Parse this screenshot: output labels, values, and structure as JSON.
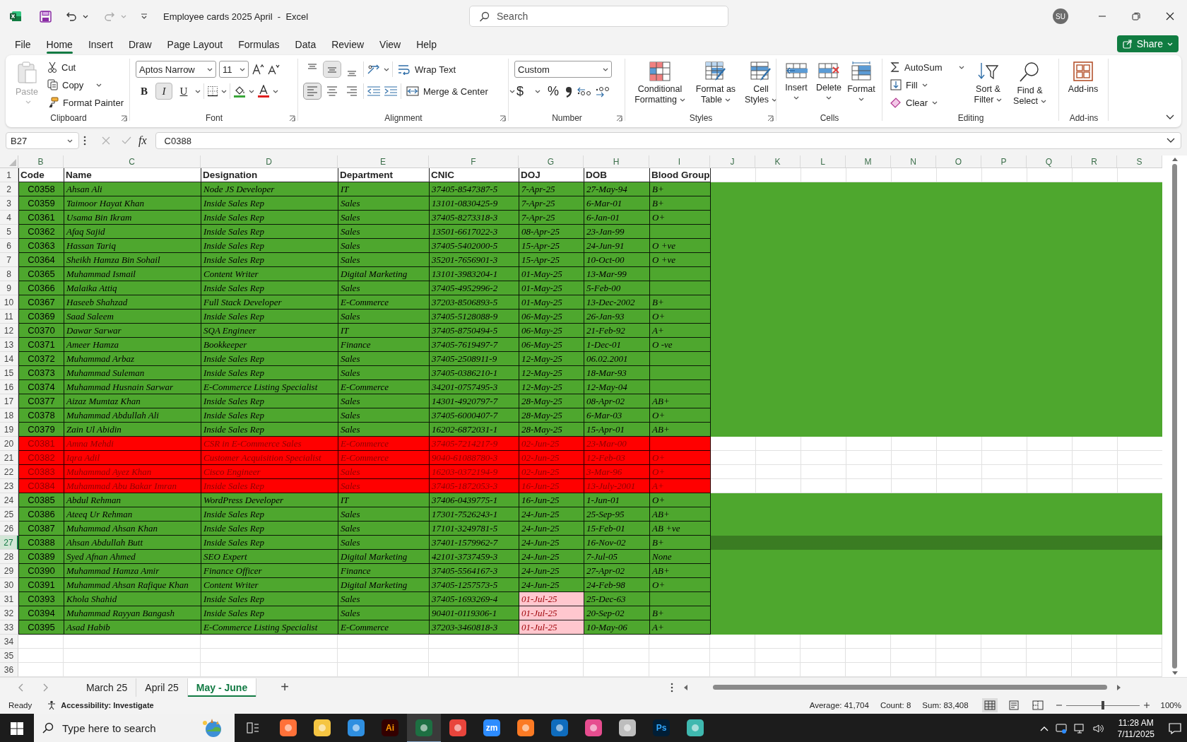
{
  "title_bar": {
    "document_title": "Employee cards 2025 April  -  Excel",
    "search_placeholder": "Search",
    "avatar_initials": "SU"
  },
  "menu_tabs": [
    {
      "label": "File",
      "selected": false
    },
    {
      "label": "Home",
      "selected": true
    },
    {
      "label": "Insert",
      "selected": false
    },
    {
      "label": "Draw",
      "selected": false
    },
    {
      "label": "Page Layout",
      "selected": false
    },
    {
      "label": "Formulas",
      "selected": false
    },
    {
      "label": "Data",
      "selected": false
    },
    {
      "label": "Review",
      "selected": false
    },
    {
      "label": "View",
      "selected": false
    },
    {
      "label": "Help",
      "selected": false
    }
  ],
  "share_button": "Share",
  "ribbon": {
    "groups": [
      {
        "kind": "clipboard",
        "label": "Clipboard",
        "paste": {
          "label": "Paste",
          "disabled": true
        },
        "cut": "Cut",
        "copy": "Copy",
        "format_painter": "Format Painter"
      },
      {
        "kind": "font",
        "label": "Font",
        "font_name": "Aptos Narrow",
        "font_size": "11",
        "styles": [
          {
            "label": "B",
            "selected": false
          },
          {
            "label": "I",
            "selected": true
          },
          {
            "label": "U",
            "selected": false
          }
        ]
      },
      {
        "kind": "alignment",
        "label": "Alignment",
        "vertical": [
          {
            "selected": false
          },
          {
            "selected": true
          },
          {
            "selected": false
          }
        ],
        "horizontal": [
          {
            "selected": true
          },
          {
            "selected": false
          },
          {
            "selected": false
          }
        ],
        "wrap_text": "Wrap Text",
        "merge": "Merge & Center"
      },
      {
        "kind": "number",
        "label": "Number",
        "format": "Custom",
        "currency": "$",
        "percent": "%"
      },
      {
        "kind": "styles",
        "label": "Styles",
        "buttons": [
          "Conditional Formatting",
          "Format as Table",
          "Cell Styles"
        ]
      },
      {
        "kind": "cells",
        "label": "Cells",
        "buttons": [
          "Insert",
          "Delete",
          "Format"
        ]
      },
      {
        "kind": "editing",
        "label": "Editing",
        "autosum": "AutoSum",
        "fill": "Fill",
        "clear": "Clear",
        "sort_filter": "Sort & Filter",
        "find_select": "Find & Select"
      },
      {
        "kind": "addins",
        "label": "Add-ins",
        "buttons": [
          "Add-ins"
        ]
      }
    ]
  },
  "formula_bar": {
    "cell_reference": "B27",
    "function_label": "fx",
    "formula": "C0388"
  },
  "grid": {
    "columns": [
      {
        "letter": "B",
        "heading": "Code"
      },
      {
        "letter": "C",
        "heading": "Name"
      },
      {
        "letter": "D",
        "heading": "Designation"
      },
      {
        "letter": "E",
        "heading": "Department"
      },
      {
        "letter": "F",
        "heading": "CNIC"
      },
      {
        "letter": "G",
        "heading": "DOJ"
      },
      {
        "letter": "H",
        "heading": "DOB"
      },
      {
        "letter": "I",
        "heading": "Blood Group"
      },
      {
        "letter": "J"
      },
      {
        "letter": "K"
      },
      {
        "letter": "L"
      },
      {
        "letter": "M"
      },
      {
        "letter": "N"
      },
      {
        "letter": "O"
      },
      {
        "letter": "P"
      },
      {
        "letter": "Q"
      },
      {
        "letter": "R"
      },
      {
        "letter": "S"
      }
    ],
    "header_row": "1",
    "rows": [
      {
        "number": "2",
        "code": "C0358",
        "name": "Ahsan Ali",
        "designation": "Node JS Developer",
        "department": "IT",
        "cnic": "37405-8547387-5",
        "doj": "7-Apr-25",
        "dob": "27-May-94",
        "blood_group": "B+",
        "color": "#4ea72e",
        "fill_extends": true,
        "selected": false,
        "doj_flagged": false
      },
      {
        "number": "3",
        "code": "C0359",
        "name": "Taimoor Hayat Khan",
        "designation": "Inside Sales Rep",
        "department": "Sales",
        "cnic": "13101-0830425-9",
        "doj": "7-Apr-25",
        "dob": "6-Mar-01",
        "blood_group": "B+",
        "color": "#4ea72e",
        "fill_extends": true,
        "selected": false,
        "doj_flagged": false
      },
      {
        "number": "4",
        "code": "C0361",
        "name": "Usama Bin Ikram",
        "designation": "Inside Sales Rep",
        "department": "Sales",
        "cnic": "37405-8273318-3",
        "doj": "7-Apr-25",
        "dob": "6-Jan-01",
        "blood_group": "O+",
        "color": "#4ea72e",
        "fill_extends": true,
        "selected": false,
        "doj_flagged": false
      },
      {
        "number": "5",
        "code": "C0362",
        "name": "Afaq Sajid",
        "designation": "Inside Sales Rep",
        "department": "Sales",
        "cnic": "13501-6617022-3",
        "doj": "08-Apr-25",
        "dob": "23-Jan-99",
        "color": "#4ea72e",
        "fill_extends": true,
        "selected": false,
        "doj_flagged": false
      },
      {
        "number": "6",
        "code": "C0363",
        "name": "Hassan Tariq",
        "designation": "Inside Sales Rep",
        "department": "Sales",
        "cnic": "37405-5402000-5",
        "doj": "15-Apr-25",
        "dob": "24-Jun-91",
        "blood_group": "O +ve",
        "color": "#4ea72e",
        "fill_extends": true,
        "selected": false,
        "doj_flagged": false
      },
      {
        "number": "7",
        "code": "C0364",
        "name": "Sheikh Hamza Bin Sohail",
        "designation": "Inside Sales Rep",
        "department": "Sales",
        "cnic": "35201-7656901-3",
        "doj": "15-Apr-25",
        "dob": "10-Oct-00",
        "blood_group": "O +ve",
        "color": "#4ea72e",
        "fill_extends": true,
        "selected": false,
        "doj_flagged": false
      },
      {
        "number": "8",
        "code": "C0365",
        "name": "Muhammad Ismail",
        "designation": "Content Writer",
        "department": "Digital Marketing",
        "cnic": "13101-3983204-1",
        "doj": "01-May-25",
        "dob": "13-Mar-99",
        "color": "#4ea72e",
        "fill_extends": true,
        "selected": false,
        "doj_flagged": false
      },
      {
        "number": "9",
        "code": "C0366",
        "name": "Malaika Attiq",
        "designation": "Inside Sales Rep",
        "department": "Sales",
        "cnic": "37405-4952996-2",
        "doj": "01-May-25",
        "dob": "5-Feb-00",
        "color": "#4ea72e",
        "fill_extends": true,
        "selected": false,
        "doj_flagged": false
      },
      {
        "number": "10",
        "code": "C0367",
        "name": "Haseeb Shahzad",
        "designation": "Full Stack Developer",
        "department": "E-Commerce",
        "cnic": "37203-8506893-5",
        "doj": "01-May-25",
        "dob": "13-Dec-2002",
        "blood_group": "B+",
        "color": "#4ea72e",
        "fill_extends": true,
        "selected": false,
        "doj_flagged": false
      },
      {
        "number": "11",
        "code": "C0369",
        "name": "Saad Saleem",
        "designation": "Inside Sales Rep",
        "department": "Sales",
        "cnic": "37405-5128088-9",
        "doj": "06-May-25",
        "dob": "26-Jan-93",
        "blood_group": "O+",
        "color": "#4ea72e",
        "fill_extends": true,
        "selected": false,
        "doj_flagged": false
      },
      {
        "number": "12",
        "code": "C0370",
        "name": "Dawar Sarwar",
        "designation": "SQA Engineer",
        "department": "IT",
        "cnic": "37405-8750494-5",
        "doj": "06-May-25",
        "dob": "21-Feb-92",
        "blood_group": "A+",
        "color": "#4ea72e",
        "fill_extends": true,
        "selected": false,
        "doj_flagged": false
      },
      {
        "number": "13",
        "code": "C0371",
        "name": "Ameer Hamza",
        "designation": "Bookkeeper",
        "department": "Finance",
        "cnic": "37405-7619497-7",
        "doj": "06-May-25",
        "dob": "1-Dec-01",
        "blood_group": "O -ve",
        "color": "#4ea72e",
        "fill_extends": true,
        "selected": false,
        "doj_flagged": false
      },
      {
        "number": "14",
        "code": "C0372",
        "name": "Muhammad Arbaz",
        "designation": "Inside Sales Rep",
        "department": "Sales",
        "cnic": "37405-2508911-9",
        "doj": "12-May-25",
        "dob": "06.02.2001",
        "color": "#4ea72e",
        "fill_extends": true,
        "selected": false,
        "doj_flagged": false
      },
      {
        "number": "15",
        "code": "C0373",
        "name": "Muhammad Suleman",
        "designation": "Inside Sales Rep",
        "department": "Sales",
        "cnic": "37405-0386210-1",
        "doj": "12-May-25",
        "dob": "18-Mar-93",
        "color": "#4ea72e",
        "fill_extends": true,
        "selected": false,
        "doj_flagged": false
      },
      {
        "number": "16",
        "code": "C0374",
        "name": "Muhammad Husnain Sarwar",
        "designation": "E-Commerce Listing Specialist",
        "department": "E-Commerce",
        "cnic": "34201-0757495-3",
        "doj": "12-May-25",
        "dob": "12-May-04",
        "color": "#4ea72e",
        "fill_extends": true,
        "selected": false,
        "doj_flagged": false
      },
      {
        "number": "17",
        "code": "C0377",
        "name": "Aizaz Mumtaz Khan",
        "designation": "Inside Sales Rep",
        "department": "Sales",
        "cnic": "14301-4920797-7",
        "doj": "28-May-25",
        "dob": "08-Apr-02",
        "blood_group": "AB+",
        "color": "#4ea72e",
        "fill_extends": true,
        "selected": false,
        "doj_flagged": false
      },
      {
        "number": "18",
        "code": "C0378",
        "name": "Muhammad Abdullah Ali",
        "designation": "Inside Sales Rep",
        "department": "Sales",
        "cnic": "37405-6000407-7",
        "doj": "28-May-25",
        "dob": "6-Mar-03",
        "blood_group": "O+",
        "color": "#4ea72e",
        "fill_extends": true,
        "selected": false,
        "doj_flagged": false
      },
      {
        "number": "19",
        "code": "C0379",
        "name": "Zain Ul Abidin",
        "designation": "Inside Sales Rep",
        "department": "Sales",
        "cnic": "16202-6872031-1",
        "doj": "28-May-25",
        "dob": "15-Apr-01",
        "blood_group": "AB+",
        "color": "#4ea72e",
        "fill_extends": true,
        "selected": false,
        "doj_flagged": false
      },
      {
        "number": "20",
        "code": "C0381",
        "name": "Amna Mehdi",
        "designation": "CSR in E-Commerce Sales",
        "department": "E-Commerce",
        "cnic": "37405-7214217-9",
        "doj": "02-Jun-25",
        "dob": "23-Mar-00",
        "color": "#ff0000",
        "fill_extends": false,
        "selected": false,
        "doj_flagged": false
      },
      {
        "number": "21",
        "code": "C0382",
        "name": "Iqra Adil",
        "designation": "Customer Acquisition Specialist",
        "department": "E-Commerce",
        "cnic": "9040-61088780-3",
        "doj": "02-Jun-25",
        "dob": "12-Feb-03",
        "blood_group": "O+",
        "color": "#ff0000",
        "fill_extends": false,
        "selected": false,
        "doj_flagged": false
      },
      {
        "number": "22",
        "code": "C0383",
        "name": "Muhammad Ayez Khan",
        "designation": "Cisco Engineer",
        "department": "Sales",
        "cnic": "16203-0372194-9",
        "doj": "02-Jun-25",
        "dob": "3-Mar-96",
        "blood_group": "O+",
        "color": "#ff0000",
        "fill_extends": false,
        "selected": false,
        "doj_flagged": false
      },
      {
        "number": "23",
        "code": "C0384",
        "name": "Muhammad Abu Bakar Imran",
        "designation": "Inside Sales Rep",
        "department": "Sales",
        "cnic": "37405-1872053-3",
        "doj": "16-Jun-25",
        "dob": "13-July-2001",
        "blood_group": "A+",
        "color": "#ff0000",
        "fill_extends": false,
        "selected": false,
        "doj_flagged": false
      },
      {
        "number": "24",
        "code": "C0385",
        "name": "Abdul Rehman",
        "designation": "WordPress Developer",
        "department": "IT",
        "cnic": "37406-0439775-1",
        "doj": "16-Jun-25",
        "dob": "1-Jun-01",
        "blood_group": "O+",
        "color": "#4ea72e",
        "fill_extends": true,
        "selected": false,
        "doj_flagged": false
      },
      {
        "number": "25",
        "code": "C0386",
        "name": "Ateeq Ur Rehman",
        "designation": "Inside Sales Rep",
        "department": "Sales",
        "cnic": "17301-7526243-1",
        "doj": "24-Jun-25",
        "dob": "25-Sep-95",
        "blood_group": "AB+",
        "color": "#4ea72e",
        "fill_extends": true,
        "selected": false,
        "doj_flagged": false
      },
      {
        "number": "26",
        "code": "C0387",
        "name": "Muhammad Ahsan Khan",
        "designation": "Inside Sales Rep",
        "department": "Sales",
        "cnic": "17101-3249781-5",
        "doj": "24-Jun-25",
        "dob": "15-Feb-01",
        "blood_group": "AB +ve",
        "color": "#4ea72e",
        "fill_extends": true,
        "selected": false,
        "doj_flagged": false
      },
      {
        "number": "27",
        "code": "C0388",
        "name": "Ahsan Abdullah Butt",
        "designation": "Inside Sales Rep",
        "department": "Sales",
        "cnic": "37401-1579962-7",
        "doj": "24-Jun-25",
        "dob": "16-Nov-02",
        "blood_group": "B+",
        "color": "#4ea72e",
        "fill_extends": true,
        "selected": true,
        "doj_flagged": false
      },
      {
        "number": "28",
        "code": "C0389",
        "name": "Syed Afnan Ahmed",
        "designation": "SEO Expert",
        "department": "Digital Marketing",
        "cnic": "42101-3737459-3",
        "doj": "24-Jun-25",
        "dob": "7-Jul-05",
        "blood_group": "None",
        "color": "#4ea72e",
        "fill_extends": true,
        "selected": false,
        "doj_flagged": false
      },
      {
        "number": "29",
        "code": "C0390",
        "name": "Muhammad Hamza Amir",
        "designation": "Finance Officer",
        "department": "Finance",
        "cnic": "37405-5564167-3",
        "doj": "24-Jun-25",
        "dob": "27-Apr-02",
        "blood_group": "AB+",
        "color": "#4ea72e",
        "fill_extends": true,
        "selected": false,
        "doj_flagged": false
      },
      {
        "number": "30",
        "code": "C0391",
        "name": "Muhammad Ahsan Rafique Khan",
        "designation": "Content Writer",
        "department": "Digital Marketing",
        "cnic": "37405-1257573-5",
        "doj": "24-Jun-25",
        "dob": "24-Feb-98",
        "blood_group": "O+",
        "color": "#4ea72e",
        "fill_extends": true,
        "selected": false,
        "doj_flagged": false
      },
      {
        "number": "31",
        "code": "C0393",
        "name": "Khola Shahid",
        "designation": "Inside Sales Rep",
        "department": "Sales",
        "cnic": "37405-1693269-4",
        "doj": "01-Jul-25",
        "dob": "25-Dec-63",
        "color": "#4ea72e",
        "fill_extends": true,
        "selected": false,
        "doj_flagged": true
      },
      {
        "number": "32",
        "code": "C0394",
        "name": "Muhammad Rayyan Bangash",
        "designation": "Inside Sales Rep",
        "department": "Sales",
        "cnic": "90401-0119306-1",
        "doj": "01-Jul-25",
        "dob": "20-Sep-02",
        "blood_group": "B+",
        "color": "#4ea72e",
        "fill_extends": true,
        "selected": false,
        "doj_flagged": true
      },
      {
        "number": "33",
        "code": "C0395",
        "name": "Asad Habib",
        "designation": "E-Commerce Listing Specialist",
        "department": "E-Commerce",
        "cnic": "37203-3460818-3",
        "doj": "01-Jul-25",
        "dob": "10-May-06",
        "blood_group": "A+",
        "color": "#4ea72e",
        "fill_extends": true,
        "selected": false,
        "doj_flagged": true
      }
    ],
    "empty_rows": [
      "34",
      "35",
      "36"
    ]
  },
  "sheet_tabs": {
    "tabs": [
      {
        "label": "March 25",
        "selected": false
      },
      {
        "label": "April 25",
        "selected": false
      },
      {
        "label": "May - June",
        "selected": true
      }
    ],
    "add_label": "+"
  },
  "status_bar": {
    "mode": "Ready",
    "accessibility": "Accessibility: Investigate",
    "average": "Average: 41,704",
    "count": "Count: 8",
    "sum": "Sum: 83,408",
    "views": [
      {
        "selected": true
      },
      {
        "selected": false
      },
      {
        "selected": false
      }
    ],
    "zoom": {
      "level": 0.5,
      "label": "100%"
    }
  },
  "taskbar": {
    "search_placeholder": "Type here to search",
    "apps": [
      {
        "color": "#ff7139",
        "selected": false
      },
      {
        "color": "#f5c542",
        "selected": false
      },
      {
        "color": "#2f8fe0",
        "selected": false
      },
      {
        "label": {
          "text": "Ai",
          "color": "#ff9a00"
        },
        "color": "#330000",
        "selected": false
      },
      {
        "color": "#1d6f42",
        "selected": true
      },
      {
        "color": "#e8453c",
        "selected": false
      },
      {
        "label": {
          "text": "zm",
          "color": "#ffffff"
        },
        "color": "#2d8cff",
        "selected": false
      },
      {
        "color": "#fb7a24",
        "selected": false
      },
      {
        "color": "#0f6cbd",
        "selected": false
      },
      {
        "color": "#e64d8f",
        "selected": false
      },
      {
        "color": "#bdbdbd",
        "selected": false
      },
      {
        "label": {
          "text": "Ps",
          "color": "#31a8ff"
        },
        "color": "#001e36",
        "selected": false
      },
      {
        "color": "#3fb8af",
        "selected": false
      }
    ],
    "time": "11:28 AM",
    "date": "7/11/2025"
  }
}
